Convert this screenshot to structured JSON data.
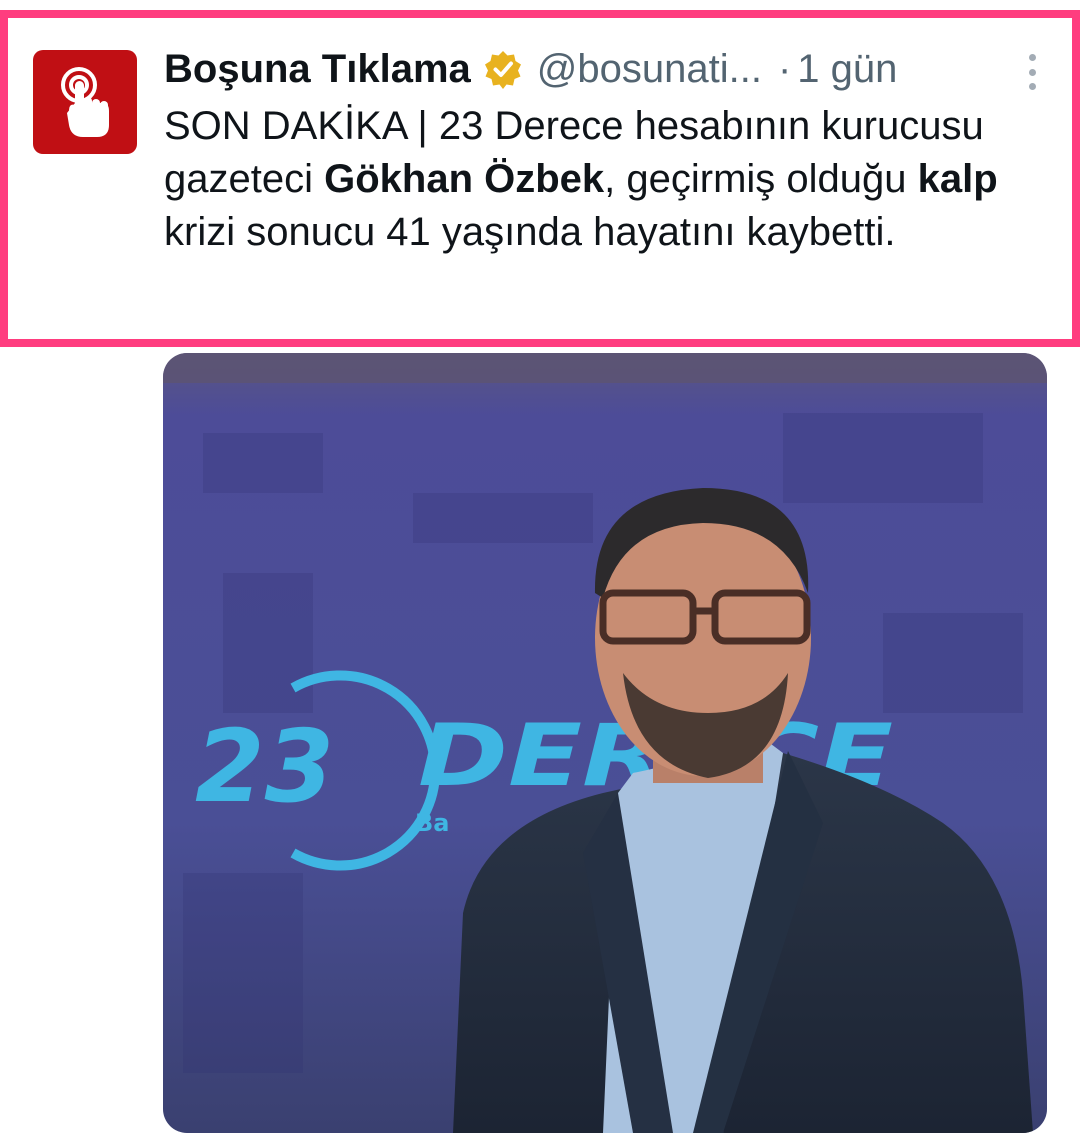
{
  "tweet": {
    "author_name": "Boşuna Tıklama",
    "handle": "@bosunati...",
    "separator": "·",
    "time": "1 gün",
    "text_parts": [
      "SON DAKİKA | 23 Derece hesabının kurucusu gazeteci ",
      "Gökhan Özbek",
      ", geçirmiş olduğu ",
      "kalp",
      " krizi sonucu 41 yaşında hayatını kaybetti."
    ]
  },
  "image": {
    "logo_number": "23",
    "logo_word": "DERECE",
    "logo_sub": "Ba"
  },
  "colors": {
    "highlight": "#ff3d7f",
    "avatar_bg": "#c00f14",
    "verified": "#e8b21f",
    "backdrop": "#4b4f9a",
    "logo": "#3fb6e3"
  },
  "icons": {
    "avatar": "tap-hand-icon",
    "verified": "verified-badge-icon",
    "more": "more-vertical-icon"
  }
}
